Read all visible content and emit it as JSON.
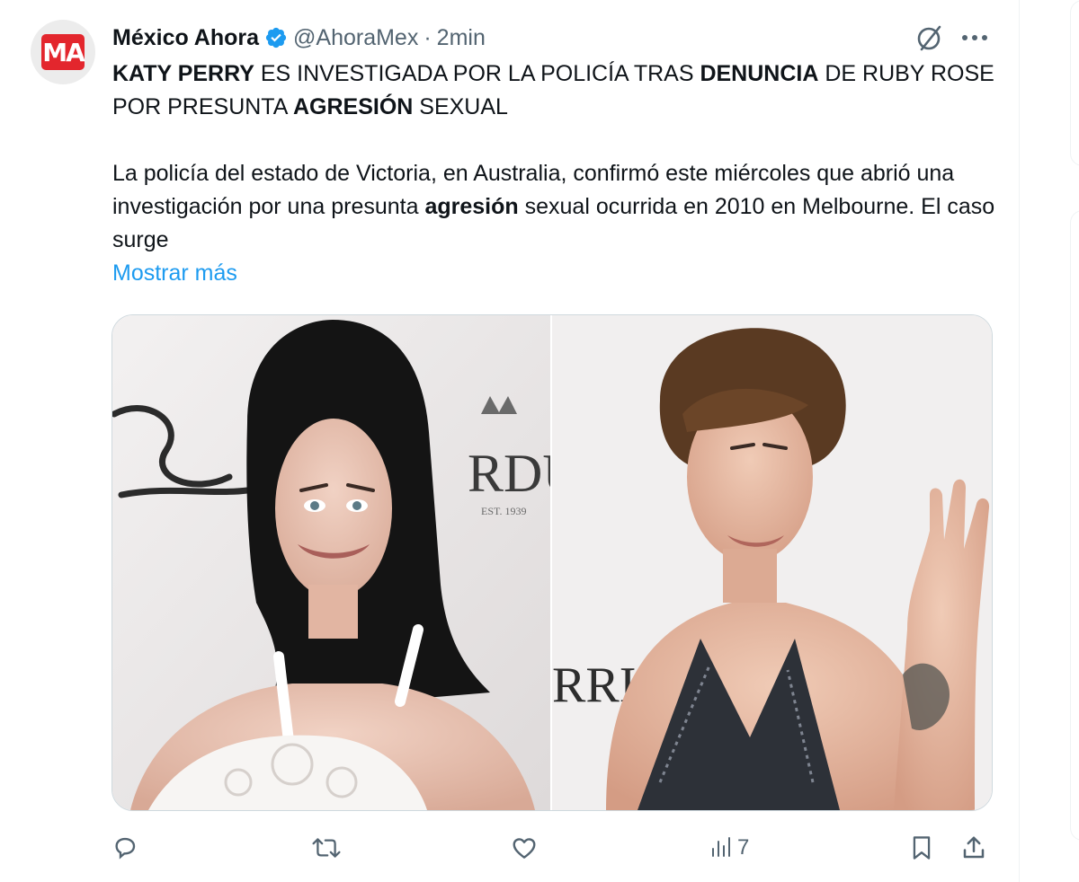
{
  "tweet": {
    "author_name": "México Ahora",
    "avatar_text": "MA",
    "handle": "@AhoraMex",
    "separator": "·",
    "time": "2min",
    "headline": {
      "p1": "KATY PERRY",
      "p2": " ES INVESTIGADA POR LA POLICÍA TRAS ",
      "p3": "DENUNCIA",
      "p4": " DE RUBY ROSE POR PRESUNTA ",
      "p5": "AGRESIÓN",
      "p6": " SEXUAL"
    },
    "body": {
      "p1": "La policía del estado de Victoria, en Australia, confirmó este miércoles que abrió una investigación por una presunta ",
      "p2": "agresión",
      "p3": " sexual ocurrida en 2010 en Melbourne. El caso surge"
    },
    "show_more": "Mostrar más",
    "media": {
      "left_backdrop_text": "RDU",
      "left_backdrop_small": "EST. 1939",
      "right_backdrop_text": "RRI"
    },
    "actions": {
      "views_count": "7"
    }
  },
  "icons": {
    "verified": "verified-badge-icon",
    "grok": "grok-icon",
    "more": "more-icon",
    "reply": "reply-icon",
    "retweet": "retweet-icon",
    "like": "like-icon",
    "views": "views-icon",
    "bookmark": "bookmark-icon",
    "share": "share-icon"
  },
  "colors": {
    "accent": "#1d9bf0",
    "text_primary": "#0f1419",
    "text_secondary": "#536471",
    "avatar_brand": "#e3262d"
  }
}
